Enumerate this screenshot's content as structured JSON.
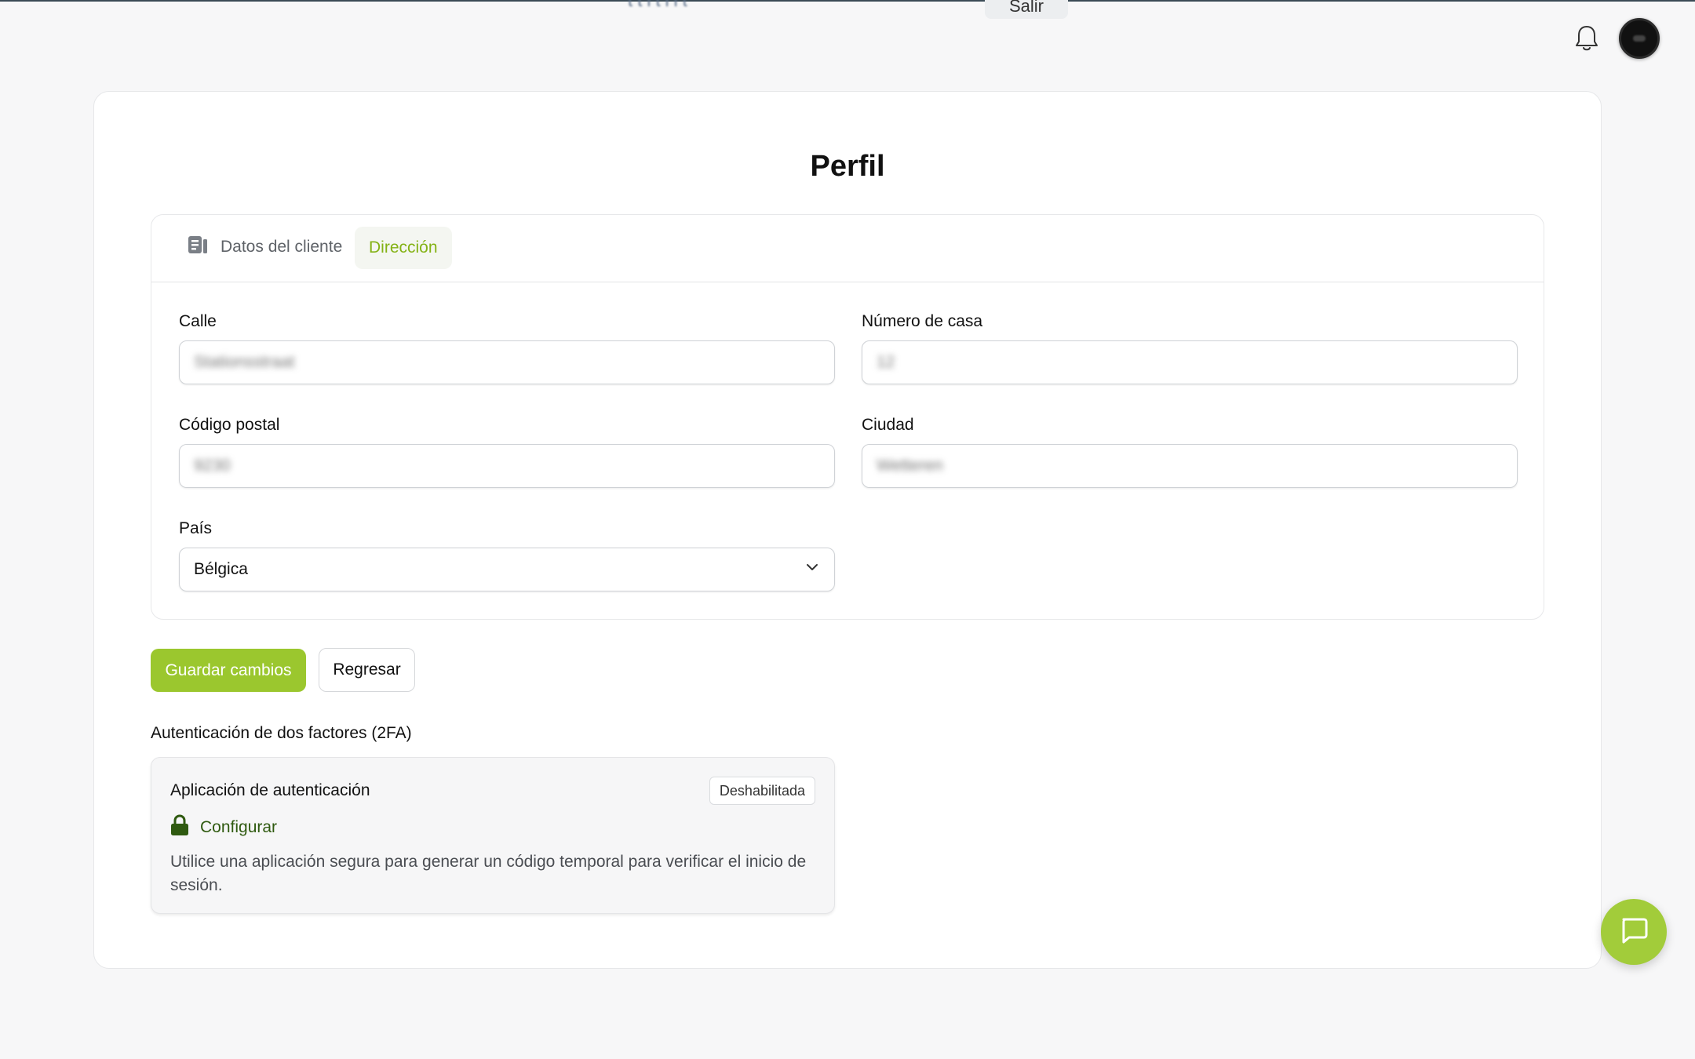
{
  "topbar": {
    "partial_text": "t t i t i i t",
    "partial_button": "Salir",
    "icons": {
      "notifications": "bell-icon",
      "user": "avatar"
    }
  },
  "page": {
    "title": "Perfil"
  },
  "tabs": [
    {
      "label": "Datos del cliente",
      "icon": "id-card-icon",
      "active": false
    },
    {
      "label": "Dirección",
      "active": true
    }
  ],
  "form": {
    "street": {
      "label": "Calle",
      "value": "Stationsstraat"
    },
    "house_number": {
      "label": "Número de casa",
      "value": "12"
    },
    "postal_code": {
      "label": "Código postal",
      "value": "9230"
    },
    "city": {
      "label": "Ciudad",
      "value": "Wetteren"
    },
    "country": {
      "label": "País",
      "value": "Bélgica"
    }
  },
  "actions": {
    "save": "Guardar cambios",
    "back": "Regresar"
  },
  "twofa": {
    "section_title": "Autenticación de dos factores (2FA)",
    "app_title": "Aplicación de autenticación",
    "status": "Deshabilitada",
    "configure": "Configurar",
    "description": "Utilice una aplicación segura para generar un código temporal para verificar el inicio de sesión."
  },
  "colors": {
    "accent": "#9bc72e",
    "active_tab_text": "#84b215",
    "configure_text": "#2f5a10",
    "chat_button": "#a2cc3a"
  }
}
